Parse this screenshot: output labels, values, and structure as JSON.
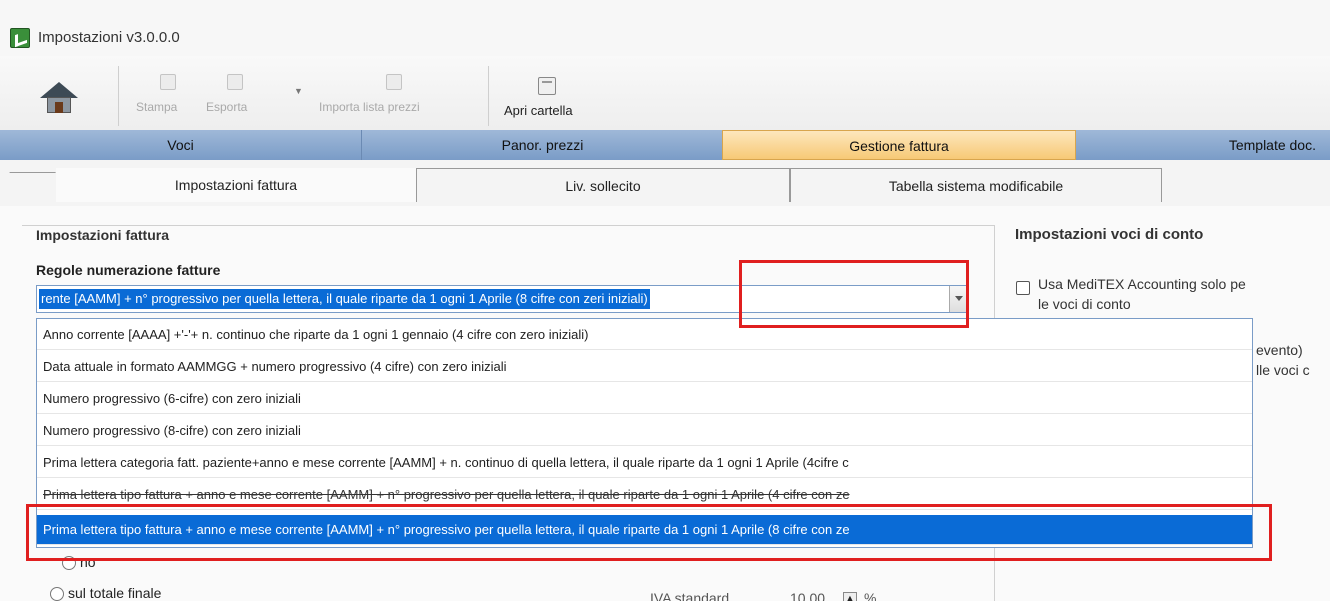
{
  "window": {
    "title": "Impostazioni v3.0.0.0"
  },
  "toolbar": {
    "print_label": "Stampa",
    "export_label": "Esporta",
    "import_label": "Importa lista prezzi",
    "open_folder_label": "Apri cartella"
  },
  "main_tabs": [
    {
      "label": "Voci"
    },
    {
      "label": "Panor. prezzi"
    },
    {
      "label": "Gestione fattura"
    },
    {
      "label": "Template doc."
    }
  ],
  "sub_tabs": [
    {
      "label": "Impostazioni fattura"
    },
    {
      "label": "Liv. sollecito"
    },
    {
      "label": "Tabella sistema modificabile"
    }
  ],
  "invoice_settings": {
    "group_title": "Impostazioni fattura",
    "numbering_label": "Regole numerazione fatture",
    "numbering_selected": "rente [AAMM] + n° progressivo per quella lettera, il quale riparte da 1 ogni 1 Aprile (8 cifre con zeri iniziali)",
    "options": [
      "Anno corrente [AAAA] +'-'+ n. continuo che riparte da 1 ogni 1 gennaio (4 cifre con zero iniziali)",
      "Data attuale in formato AAMMGG + numero progressivo (4 cifre) con zero iniziali",
      "Numero progressivo (6-cifre) con zero iniziali",
      "Numero progressivo (8-cifre) con zero iniziali",
      "Prima lettera categoria fatt. paziente+anno e mese corrente [AAMM] + n. continuo di quella lettera, il quale riparte da 1 ogni 1 Aprile (4cifre c",
      "Prima lettera tipo fattura + anno e mese corrente [AAMM] + n° progressivo per quella lettera, il quale riparte da 1 ogni 1 Aprile (4 cifre con ze",
      "Prima lettera tipo fattura + anno e mese corrente [AAMM] + n° progressivo per quella lettera, il quale riparte da 1 ogni 1 Aprile (8 cifre con ze"
    ],
    "highlighted_option_index": 6,
    "radio_no": "no",
    "radio_total": "sul totale finale",
    "standard_label": "IVA standard",
    "standard_value": "10,00",
    "standard_unit": "%"
  },
  "account_settings": {
    "group_title": "Impostazioni voci di conto",
    "checkbox_line1": "Usa MediTEX Accounting solo pe",
    "checkbox_line2": "le voci di conto",
    "partial_line1": "evento)",
    "partial_line2": "lle voci c"
  },
  "colors": {
    "highlight": "#0a6bd6",
    "annotation": "#e01f1f",
    "active_tab": "#f7c976"
  }
}
